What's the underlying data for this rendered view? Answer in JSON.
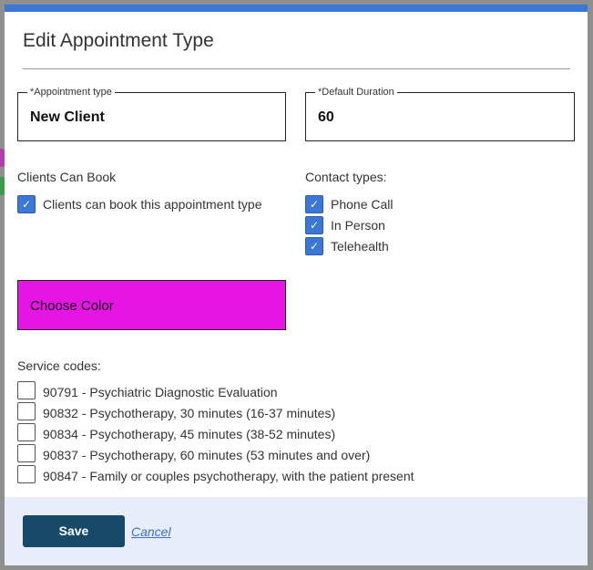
{
  "modal": {
    "title": "Edit Appointment Type",
    "appointment_type": {
      "label": "*Appointment type",
      "value": "New Client"
    },
    "default_duration": {
      "label": "*Default Duration",
      "value": "60"
    },
    "clients_can_book": {
      "heading": "Clients Can Book",
      "option": {
        "label": "Clients can book this appointment type",
        "checked": true
      }
    },
    "contact_types": {
      "heading": "Contact types:",
      "options": [
        {
          "label": "Phone Call",
          "checked": true
        },
        {
          "label": "In Person",
          "checked": true
        },
        {
          "label": "Telehealth",
          "checked": true
        }
      ]
    },
    "choose_color": {
      "label": "Choose Color",
      "color": "#e516e3"
    },
    "service_codes": {
      "heading": "Service codes:",
      "options": [
        {
          "label": "90791 - Psychiatric Diagnostic Evaluation",
          "checked": false
        },
        {
          "label": "90832 - Psychotherapy, 30 minutes (16-37 minutes)",
          "checked": false
        },
        {
          "label": "90834 - Psychotherapy, 45 minutes (38-52 minutes)",
          "checked": false
        },
        {
          "label": "90837 - Psychotherapy, 60 minutes (53 minutes and over)",
          "checked": false
        },
        {
          "label": "90847 - Family or couples psychotherapy, with the patient present",
          "checked": false
        }
      ]
    },
    "footer": {
      "save": "Save",
      "cancel": "Cancel"
    },
    "check_glyph": "✓"
  }
}
